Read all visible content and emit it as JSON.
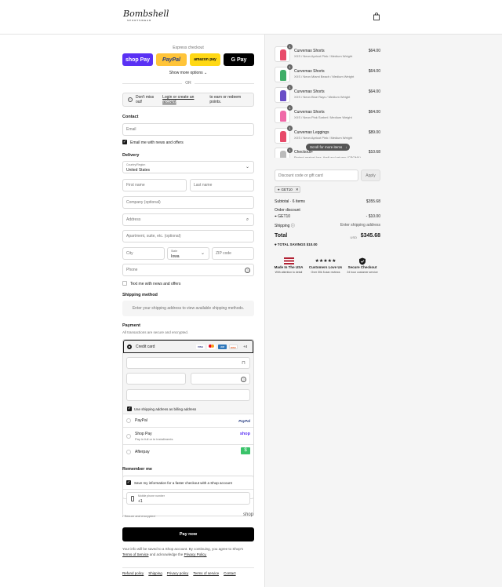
{
  "header": {
    "logo_text": "Bombshell",
    "logo_sub": "SPORTSWEAR"
  },
  "express": {
    "label": "Express checkout",
    "shop_pay": "shop Pay",
    "paypal": "PayPal",
    "amazon_pay": "amazon pay",
    "google_pay": "G Pay",
    "show_more": "Show more options",
    "or": "OR"
  },
  "notice": {
    "prefix": "Don't miss out!",
    "link": "Login or create an account",
    "suffix": "to earn or redeem points."
  },
  "contact": {
    "title": "Contact",
    "email_placeholder": "Email",
    "email_news_label": "Email me with news and offers"
  },
  "delivery": {
    "title": "Delivery",
    "country_label": "Country/Region",
    "country_value": "United States",
    "first_name": "First name",
    "last_name": "Last name",
    "company": "Company (optional)",
    "address": "Address",
    "apartment": "Apartment, suite, etc. (optional)",
    "city": "City",
    "state_label": "State",
    "state_value": "Iowa",
    "zip": "ZIP code",
    "phone": "Phone",
    "text_news_label": "Text me with news and offers"
  },
  "shipping": {
    "title": "Shipping method",
    "placeholder": "Enter your shipping address to view available shipping methods."
  },
  "payment": {
    "title": "Payment",
    "subtitle": "All transactions are secure and encrypted.",
    "credit_card": "Credit card",
    "more_brands": "+4",
    "billing_label": "Use shipping address as billing address",
    "paypal": "PayPal",
    "paypal_logo": "PayPal",
    "shop_pay": "Shop Pay",
    "shop_pay_sub": "Pay in full or in installments",
    "shop_logo": "shop",
    "afterpay": "Afterpay"
  },
  "remember": {
    "title": "Remember me",
    "save_label": "Save my information for a faster checkout with a Shop account",
    "phone_label": "Mobile phone number",
    "phone_value": "+1",
    "secure": "Secure and encrypted",
    "shop_logo": "shop"
  },
  "pay_now": "Pay now",
  "legal": {
    "text": "Your info will be saved to a Shop account. By continuing, you agree to Shop's",
    "terms": "Terms of Service",
    "mid": "and acknowledge the",
    "privacy": "Privacy Policy."
  },
  "footer": [
    "Refund policy",
    "Shipping",
    "Privacy policy",
    "Terms of service",
    "Contact"
  ],
  "order": {
    "items": [
      {
        "qty": "1",
        "name": "Curvemax Shorts",
        "variant": "XXS / Neon Apricot Pink / Medium Weight",
        "price": "$64.00",
        "color": "#e84b6a"
      },
      {
        "qty": "1",
        "name": "Curvemax Shorts",
        "variant": "XXS / Neon Miami Beach / Medium Weight",
        "price": "$64.00",
        "color": "#3fae68"
      },
      {
        "qty": "1",
        "name": "Curvemax Shorts",
        "variant": "XXS / Neon Blue Rays / Medium Weight",
        "price": "$64.00",
        "color": "#6a4fc7"
      },
      {
        "qty": "1",
        "name": "Curvemax Shorts",
        "variant": "XXS / Neon Pink Sorbet / Medium Weight",
        "price": "$64.00",
        "color": "#f06aa8"
      },
      {
        "qty": "1",
        "name": "Curvemax Leggings",
        "variant": "XXS / Neon Apricot Pink / Medium Weight",
        "price": "$89.00",
        "color": "#e84b6a"
      },
      {
        "qty": "1",
        "name": "Checkout+",
        "variant": "Protect against loss, theft and returns (CROMA)",
        "price": "$10.68",
        "color": "#bbbbbb"
      }
    ],
    "scroll_hint": "Scroll for more items",
    "discount_placeholder": "Discount code or gift card",
    "apply": "Apply",
    "code": "GET10",
    "subtotal_label": "Subtotal · 6 items",
    "subtotal_value": "$355.68",
    "order_discount_label": "Order discount",
    "discount_code": "GET10",
    "discount_value": "- $10.00",
    "shipping_label": "Shipping",
    "shipping_value": "Enter shipping address",
    "total_label": "Total",
    "currency": "USD",
    "total_value": "$345.68",
    "savings_label": "TOTAL SAVINGS",
    "savings_value": "$10.00",
    "stars": "★★★★★",
    "badges": [
      {
        "title": "Made In The USA",
        "sub": "With attention to detail"
      },
      {
        "title": "Customers Love Us",
        "sub": "Over 30k 5-star reviews"
      },
      {
        "title": "Secure Checkout",
        "sub": "24 hour customer service"
      }
    ]
  },
  "colors": {
    "primary": "#000000",
    "shop_pay": "#5a31f4",
    "paypal": "#ffc439",
    "amazon": "#ffd814"
  }
}
